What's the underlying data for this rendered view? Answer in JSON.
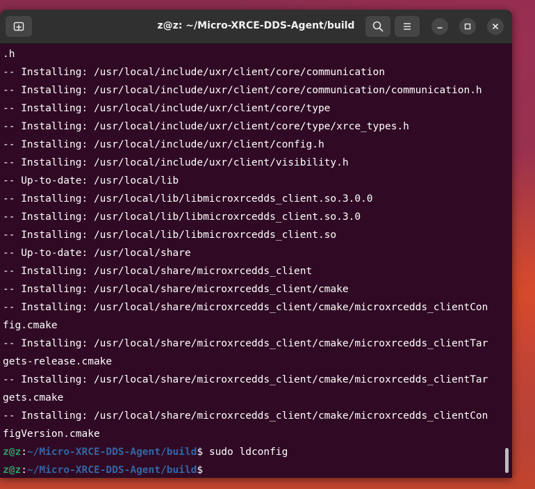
{
  "window": {
    "title": "z@z: ~/Micro-XRCE-DDS-Agent/build"
  },
  "icons": {
    "new_tab": "new-tab-icon",
    "search": "search-icon",
    "menu": "hamburger-menu-icon",
    "minimize": "minimize-icon",
    "maximize": "maximize-icon",
    "close": "close-icon"
  },
  "colors": {
    "terminal_bg": "#300a24",
    "prompt_user": "#26a269",
    "prompt_path": "#3465a4"
  },
  "terminal": {
    "lines": [
      ".h",
      "-- Installing: /usr/local/include/uxr/client/core/communication",
      "-- Installing: /usr/local/include/uxr/client/core/communication/communication.h",
      "-- Installing: /usr/local/include/uxr/client/core/type",
      "-- Installing: /usr/local/include/uxr/client/core/type/xrce_types.h",
      "-- Installing: /usr/local/include/uxr/client/config.h",
      "-- Installing: /usr/local/include/uxr/client/visibility.h",
      "-- Up-to-date: /usr/local/lib",
      "-- Installing: /usr/local/lib/libmicroxrcedds_client.so.3.0.0",
      "-- Installing: /usr/local/lib/libmicroxrcedds_client.so.3.0",
      "-- Installing: /usr/local/lib/libmicroxrcedds_client.so",
      "-- Up-to-date: /usr/local/share",
      "-- Installing: /usr/local/share/microxrcedds_client",
      "-- Installing: /usr/local/share/microxrcedds_client/cmake",
      "-- Installing: /usr/local/share/microxrcedds_client/cmake/microxrcedds_clientCon",
      "fig.cmake",
      "-- Installing: /usr/local/share/microxrcedds_client/cmake/microxrcedds_clientTar",
      "gets-release.cmake",
      "-- Installing: /usr/local/share/microxrcedds_client/cmake/microxrcedds_clientTar",
      "gets.cmake",
      "-- Installing: /usr/local/share/microxrcedds_client/cmake/microxrcedds_clientCon",
      "figVersion.cmake"
    ],
    "prompts": [
      {
        "user": "z@z",
        "colon": ":",
        "path": "~/Micro-XRCE-DDS-Agent/build",
        "dollar": "$",
        "command": " sudo ldconfig"
      },
      {
        "user": "z@z",
        "colon": ":",
        "path": "~/Micro-XRCE-DDS-Agent/build",
        "dollar": "$",
        "command": ""
      }
    ]
  }
}
